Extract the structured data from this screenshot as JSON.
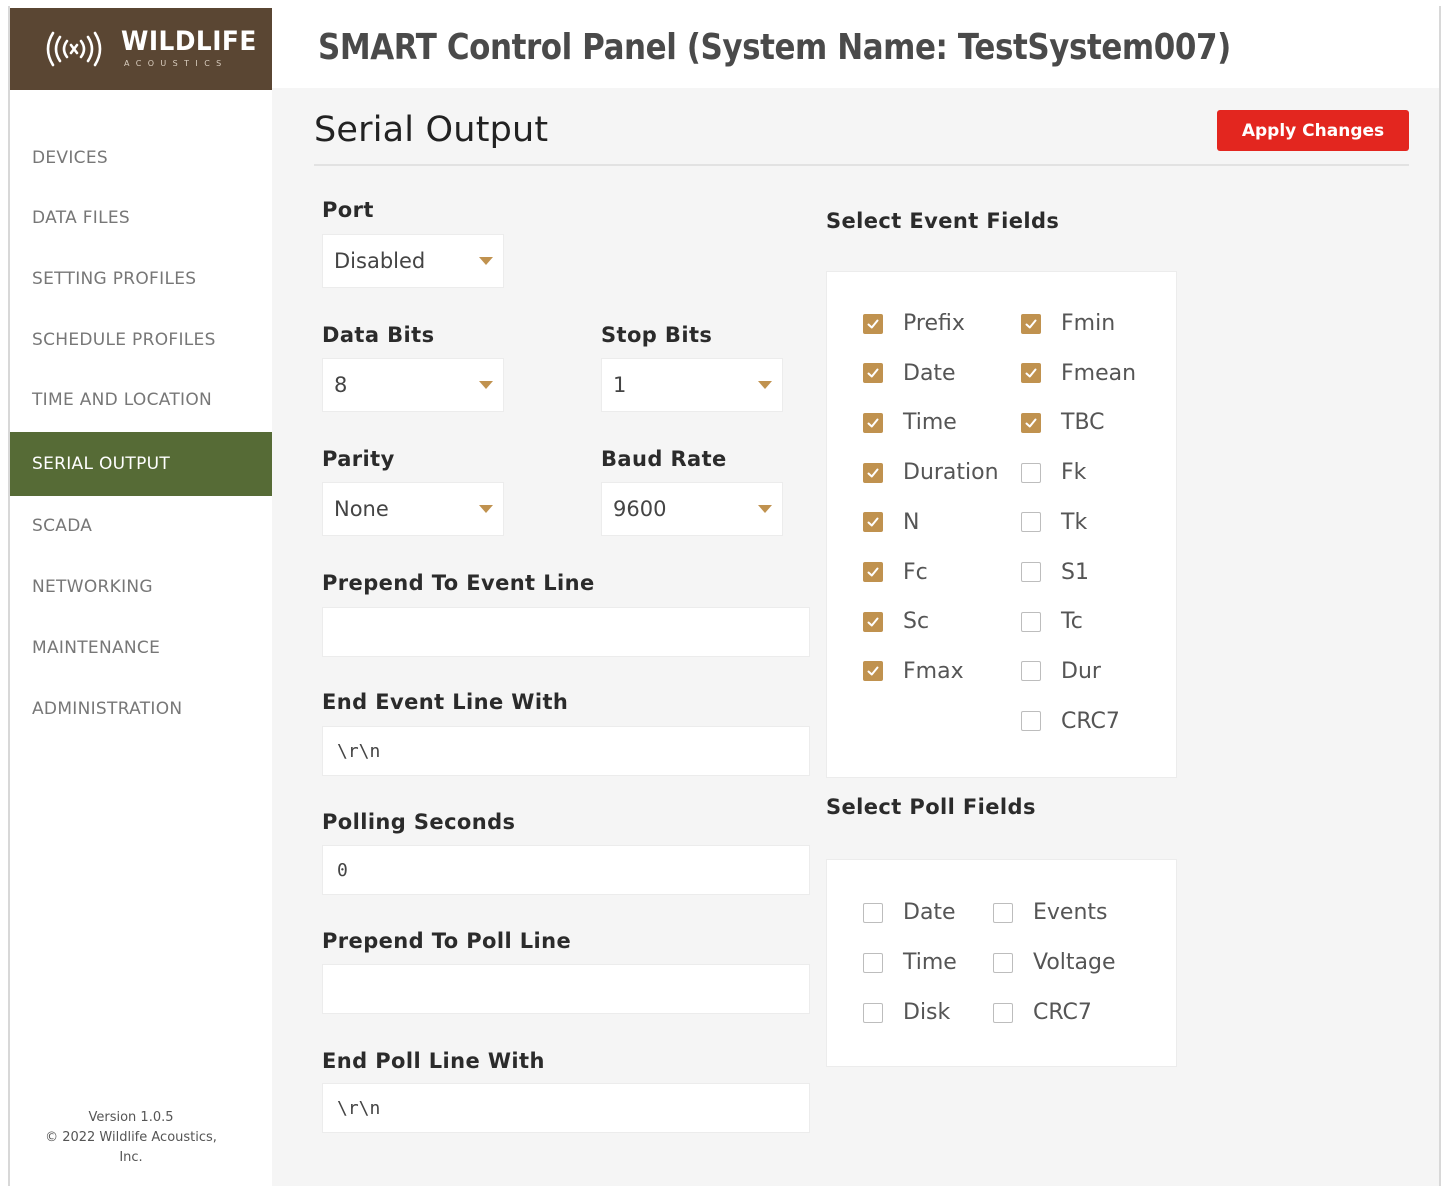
{
  "brand": {
    "name": "WILDLIFE",
    "sub": "ACOUSTICS",
    "accent": "#c0924f",
    "logo_bg": "#5a4633",
    "nav_active_bg": "#566b36",
    "apply_bg": "#e3261f"
  },
  "header": {
    "title": "SMART Control Panel  (System Name:  TestSystem007)"
  },
  "sidebar": {
    "items": [
      {
        "label": "DEVICES"
      },
      {
        "label": "DATA FILES"
      },
      {
        "label": "SETTING PROFILES"
      },
      {
        "label": "SCHEDULE PROFILES"
      },
      {
        "label": "TIME AND LOCATION"
      },
      {
        "label": "SERIAL OUTPUT"
      },
      {
        "label": "SCADA"
      },
      {
        "label": "NETWORKING"
      },
      {
        "label": "MAINTENANCE"
      },
      {
        "label": "ADMINISTRATION"
      }
    ],
    "active": "SERIAL OUTPUT",
    "version": "Version 1.0.5",
    "copyright_1": "© 2022 Wildlife Acoustics,",
    "copyright_2": "Inc."
  },
  "page": {
    "title": "Serial Output",
    "apply_label": "Apply Changes"
  },
  "form": {
    "port": {
      "label": "Port",
      "value": "Disabled"
    },
    "data_bits": {
      "label": "Data Bits",
      "value": "8"
    },
    "stop_bits": {
      "label": "Stop Bits",
      "value": "1"
    },
    "parity": {
      "label": "Parity",
      "value": "None"
    },
    "baud_rate": {
      "label": "Baud Rate",
      "value": "9600"
    },
    "prepend_event": {
      "label": "Prepend To Event Line",
      "value": ""
    },
    "end_event": {
      "label": "End Event Line With",
      "value": "\\r\\n"
    },
    "polling": {
      "label": "Polling Seconds",
      "value": "0"
    },
    "prepend_poll": {
      "label": "Prepend To Poll Line",
      "value": ""
    },
    "end_poll": {
      "label": "End Poll Line With",
      "value": "\\r\\n"
    }
  },
  "event_fields": {
    "title": "Select Event Fields",
    "left": [
      {
        "label": "Prefix",
        "checked": true
      },
      {
        "label": "Date",
        "checked": true
      },
      {
        "label": "Time",
        "checked": true
      },
      {
        "label": "Duration",
        "checked": true
      },
      {
        "label": "N",
        "checked": true
      },
      {
        "label": "Fc",
        "checked": true
      },
      {
        "label": "Sc",
        "checked": true
      },
      {
        "label": "Fmax",
        "checked": true
      }
    ],
    "right": [
      {
        "label": "Fmin",
        "checked": true
      },
      {
        "label": "Fmean",
        "checked": true
      },
      {
        "label": "TBC",
        "checked": true
      },
      {
        "label": "Fk",
        "checked": false
      },
      {
        "label": "Tk",
        "checked": false
      },
      {
        "label": "S1",
        "checked": false
      },
      {
        "label": "Tc",
        "checked": false
      },
      {
        "label": "Dur",
        "checked": false
      },
      {
        "label": "CRC7",
        "checked": false
      }
    ]
  },
  "poll_fields": {
    "title": "Select Poll Fields",
    "left": [
      {
        "label": "Date",
        "checked": false
      },
      {
        "label": "Time",
        "checked": false
      },
      {
        "label": "Disk",
        "checked": false
      }
    ],
    "right": [
      {
        "label": "Events",
        "checked": false
      },
      {
        "label": "Voltage",
        "checked": false
      },
      {
        "label": "CRC7",
        "checked": false
      }
    ]
  }
}
